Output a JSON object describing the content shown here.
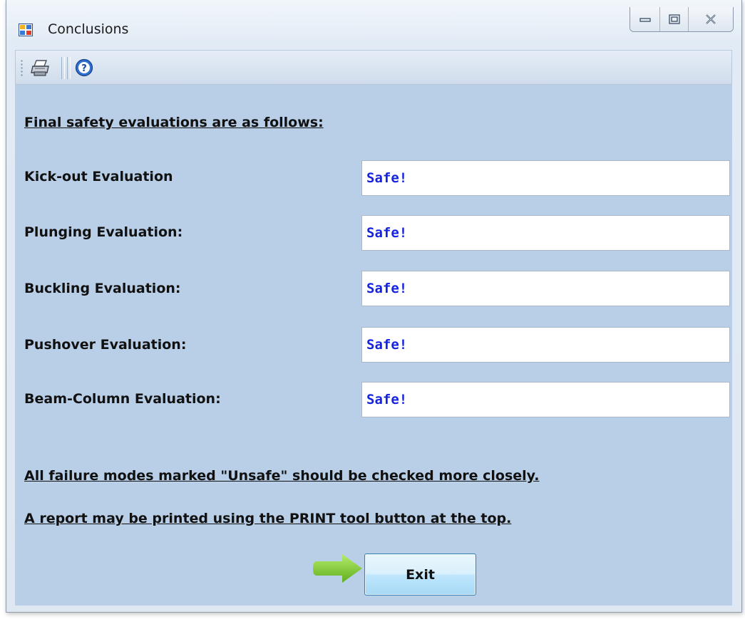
{
  "window": {
    "title": "Conclusions"
  },
  "toolbar": {
    "items": [
      {
        "name": "print",
        "icon": "printer-icon"
      },
      {
        "name": "help",
        "icon": "help-icon"
      }
    ]
  },
  "main": {
    "heading": "Final safety evaluations are as follows:",
    "evaluations": [
      {
        "label": "Kick-out Evaluation",
        "value": "Safe!"
      },
      {
        "label": "Plunging Evaluation:",
        "value": "Safe!"
      },
      {
        "label": "Buckling Evaluation:",
        "value": "Safe!"
      },
      {
        "label": "Pushover Evaluation:",
        "value": "Safe!"
      },
      {
        "label": "Beam-Column Evaluation:",
        "value": "Safe!"
      }
    ],
    "note1": "All failure modes marked \"Unsafe\" should be checked more closely.",
    "note2": "A report may be printed using the PRINT tool button at the top.",
    "exit_label": "Exit"
  },
  "colors": {
    "client_background": "#b8cfe7",
    "value_text": "#1522e0",
    "arrow": "#7ccd2f"
  }
}
